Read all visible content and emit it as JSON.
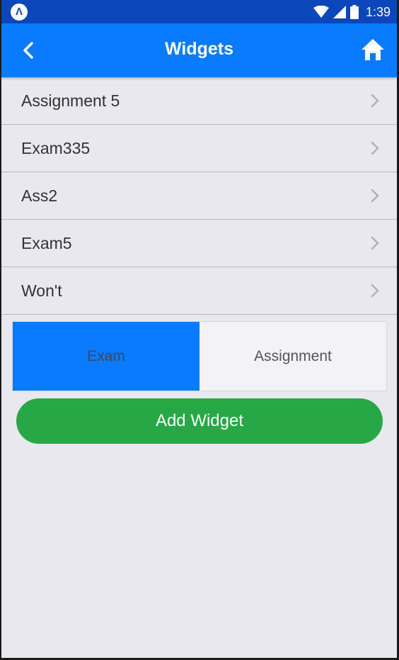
{
  "status_bar": {
    "time": "1:39",
    "logo_letter": "Λ"
  },
  "app_bar": {
    "title": "Widgets",
    "back_icon": "chevron-left-icon",
    "home_icon": "home-icon"
  },
  "widgets": [
    {
      "label": "Assignment 5"
    },
    {
      "label": "Exam335"
    },
    {
      "label": "Ass2"
    },
    {
      "label": "Exam5"
    },
    {
      "label": "Won't"
    }
  ],
  "type_selector": {
    "options": [
      "Exam",
      "Assignment"
    ],
    "selected": "Exam"
  },
  "add_button": {
    "label": "Add Widget"
  },
  "colors": {
    "status_bar": "#0b47b8",
    "app_bar": "#0a7aff",
    "selected_segment": "#0a7aff",
    "add_button": "#28a745",
    "background": "#e8e8ee"
  }
}
